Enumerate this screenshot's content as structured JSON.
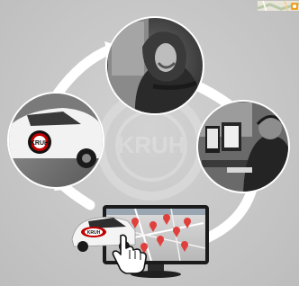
{
  "header": {
    "map_thumbnail_icon": "map-pin-icon"
  },
  "illustration": {
    "watermark_brand": "KRUH",
    "car_door_logo": "KRUH",
    "car_roof_logo": "KRUH",
    "cursor_icon": "hand-pointer-icon",
    "cycle_arrow_color": "#ffffff",
    "map_pin_color": "#e0403c",
    "background_color": "#c8c8c8"
  }
}
